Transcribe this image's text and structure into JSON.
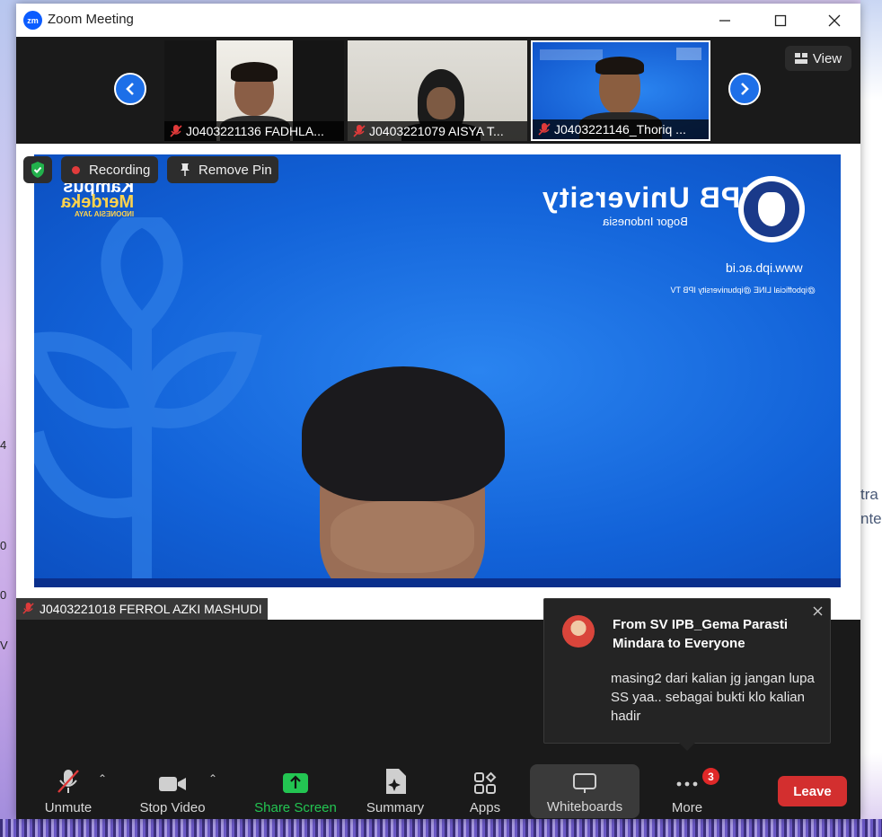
{
  "window": {
    "title": "Zoom Meeting",
    "logo_text": "zm"
  },
  "desktop": {
    "peek_lines": [
      "tra",
      "nte"
    ],
    "left_edge_marks": [
      "4",
      "0",
      "0",
      "V"
    ]
  },
  "strip": {
    "participants": [
      {
        "label": "J0403221136 FADHLA..."
      },
      {
        "label": "J0403221079 AISYA T..."
      },
      {
        "label": "J0403221146_Thoriq ..."
      }
    ],
    "view_label": "View"
  },
  "main": {
    "recording_label": "Recording",
    "remove_pin_label": "Remove Pin",
    "speaker_label": "J0403221018 FERROL AZKI MASHUDI",
    "slide": {
      "brand": "IPB University",
      "tagline": "Bogor Indonesia",
      "website": "www.ipb.ac.id",
      "socials": "@ipbofficial   LINE   @ipbuniversity   IPB TV",
      "campaign_line1": "Kampus",
      "campaign_line2": "Merdeka",
      "campaign_line3": "INDONESIA JAYA"
    }
  },
  "chat": {
    "from": "From SV IPB_Gema Parasti Mindara to Everyone",
    "message": "masing2 dari kalian jg jangan lupa SS yaa.. sebagai bukti klo kalian hadir"
  },
  "toolbar": {
    "unmute": "Unmute",
    "stop_video": "Stop Video",
    "share_screen": "Share Screen",
    "summary": "Summary",
    "apps": "Apps",
    "whiteboards": "Whiteboards",
    "more": "More",
    "more_badge": "3",
    "leave": "Leave"
  },
  "colors": {
    "accent_blue": "#1d6fe8",
    "share_green": "#23c552",
    "leave_red": "#d32f2f",
    "slide_blue": "#1262d8"
  }
}
